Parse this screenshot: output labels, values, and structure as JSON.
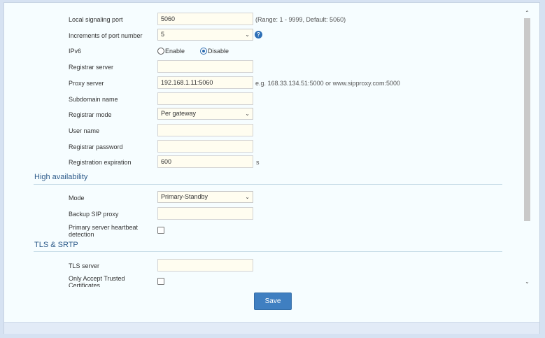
{
  "sip": {
    "local_port": {
      "label": "Local signaling port",
      "value": "5060",
      "hint": "(Range: 1 - 9999, Default: 5060)"
    },
    "port_increment": {
      "label": "Increments of port number",
      "value": "5",
      "help_icon": "question-circle-icon"
    },
    "ipv6": {
      "label": "IPv6",
      "options": [
        "Enable",
        "Disable"
      ],
      "selected": "Disable"
    },
    "registrar_server": {
      "label": "Registrar server",
      "value": ""
    },
    "proxy_server": {
      "label": "Proxy server",
      "value": "192.168.1.11:5060",
      "hint": "e.g. 168.33.134.51:5000 or www.sipproxy.com:5000"
    },
    "subdomain": {
      "label": "Subdomain name",
      "value": ""
    },
    "registrar_mode": {
      "label": "Registrar mode",
      "value": "Per gateway"
    },
    "user_name": {
      "label": "User name",
      "value": ""
    },
    "registrar_password": {
      "label": "Registrar password",
      "value": ""
    },
    "registration_expiration": {
      "label": "Registration expiration",
      "value": "600",
      "unit": "s"
    }
  },
  "high_availability": {
    "title": "High availability",
    "mode": {
      "label": "Mode",
      "value": "Primary-Standby"
    },
    "backup_proxy": {
      "label": "Backup SIP proxy",
      "value": ""
    },
    "heartbeat": {
      "label": "Primary server heartbeat detection",
      "checked": false
    }
  },
  "tls": {
    "title": "TLS & SRTP",
    "tls_server": {
      "label": "TLS server",
      "value": ""
    },
    "trusted_certs": {
      "label": "Only Accept Trusted Certificates",
      "checked": false
    }
  },
  "actions": {
    "save_label": "Save"
  },
  "colors": {
    "accent": "#3f7fc1",
    "section_title": "#2c5a8a",
    "input_bg": "#fffdf0"
  }
}
